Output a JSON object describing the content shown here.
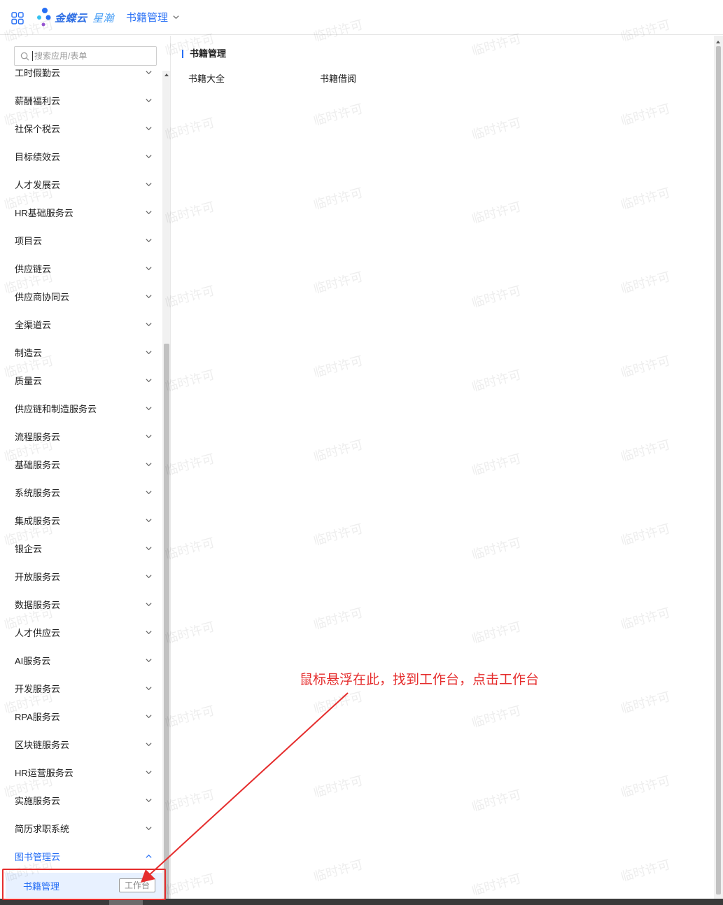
{
  "header": {
    "brand": "金蝶云·星瀚",
    "brand_main": "金蝶云",
    "brand_sub": "星瀚",
    "current_app": "书籍管理"
  },
  "sidebar": {
    "search_placeholder": "搜索应用/表单",
    "items": [
      {
        "label": "工时假勤云"
      },
      {
        "label": "薪酬福利云"
      },
      {
        "label": "社保个税云"
      },
      {
        "label": "目标绩效云"
      },
      {
        "label": "人才发展云"
      },
      {
        "label": "HR基础服务云"
      },
      {
        "label": "项目云"
      },
      {
        "label": "供应链云"
      },
      {
        "label": "供应商协同云"
      },
      {
        "label": "全渠道云"
      },
      {
        "label": "制造云"
      },
      {
        "label": "质量云"
      },
      {
        "label": "供应链和制造服务云"
      },
      {
        "label": "流程服务云"
      },
      {
        "label": "基础服务云"
      },
      {
        "label": "系统服务云"
      },
      {
        "label": "集成服务云"
      },
      {
        "label": "银企云"
      },
      {
        "label": "开放服务云"
      },
      {
        "label": "数据服务云"
      },
      {
        "label": "人才供应云"
      },
      {
        "label": "AI服务云"
      },
      {
        "label": "开发服务云"
      },
      {
        "label": "RPA服务云"
      },
      {
        "label": "区块链服务云"
      },
      {
        "label": "HR运营服务云"
      },
      {
        "label": "实施服务云"
      },
      {
        "label": "简历求职系统"
      },
      {
        "label": "图书管理云"
      }
    ],
    "active_item": "图书管理云",
    "sub_item": {
      "label": "书籍管理",
      "tag": "工作台"
    }
  },
  "main": {
    "section_title": "书籍管理",
    "links": [
      "书籍大全",
      "书籍借阅"
    ]
  },
  "watermark": "临时许可",
  "annotation": "鼠标悬浮在此，找到工作台，点击工作台",
  "colors": {
    "accent": "#276ff5",
    "annotation": "#e52d2d",
    "active_bg": "#e8f1ff"
  }
}
